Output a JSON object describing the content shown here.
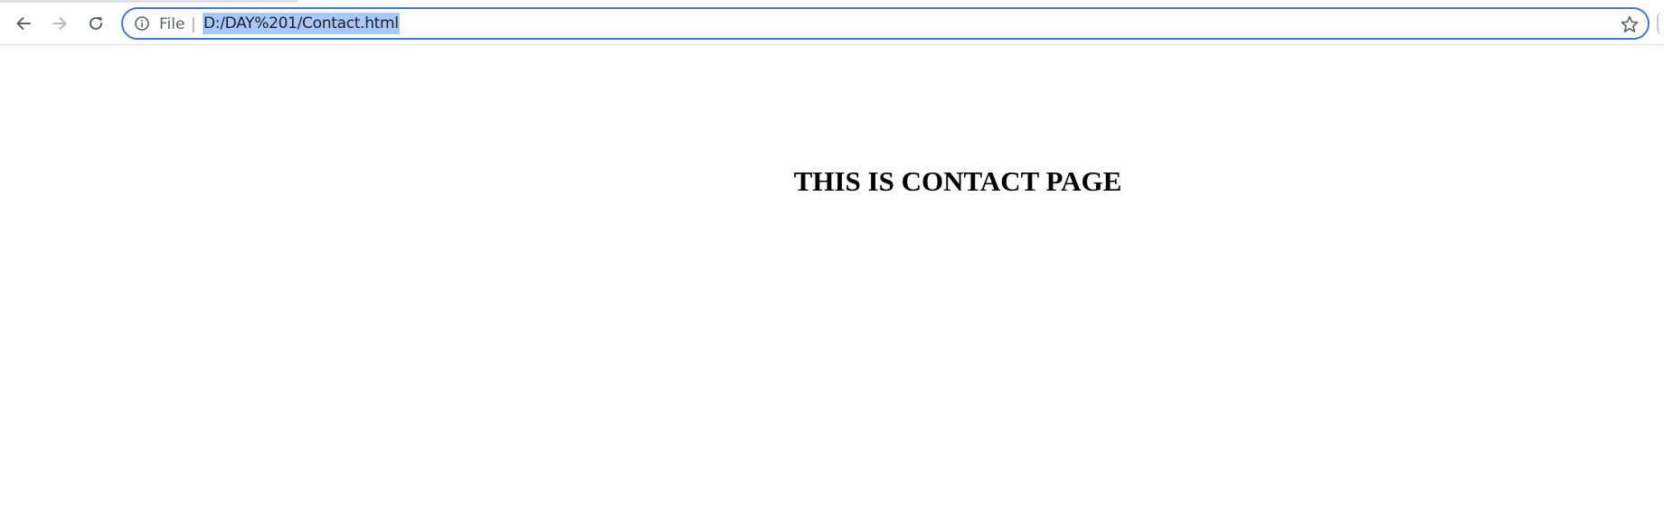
{
  "browser": {
    "toolbar": {
      "back_icon": "arrow-left-icon",
      "forward_icon": "arrow-right-icon",
      "reload_icon": "reload-icon",
      "bookmark_icon": "star-icon"
    },
    "omnibox": {
      "security_icon": "info-icon",
      "scheme_label": "File",
      "separator": "|",
      "url": "D:/DAY%201/Contact.html",
      "url_selected": true,
      "focus_color": "#3b78e7",
      "selection_color": "#a8c8f8"
    }
  },
  "page": {
    "heading": "THIS IS CONTACT PAGE"
  }
}
